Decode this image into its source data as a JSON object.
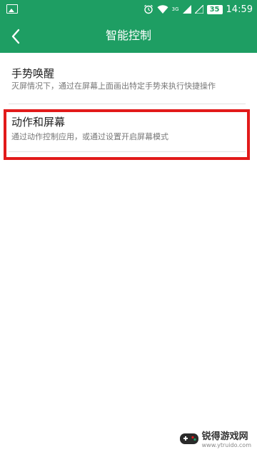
{
  "status_bar": {
    "network": "3G",
    "battery": "35",
    "time": "14:59"
  },
  "app_bar": {
    "title": "智能控制"
  },
  "items": [
    {
      "title": "手势唤醒",
      "subtitle": "灭屏情况下，通过在屏幕上面画出特定手势来执行快捷操作"
    },
    {
      "title": "动作和屏幕",
      "subtitle": "通过动作控制应用，或通过设置开启屏幕模式"
    }
  ],
  "watermark": {
    "brand": "锐得游戏网",
    "url": "www.ytruido.com"
  },
  "colors": {
    "primary": "#1e9e63",
    "highlight": "#e21a1a"
  }
}
